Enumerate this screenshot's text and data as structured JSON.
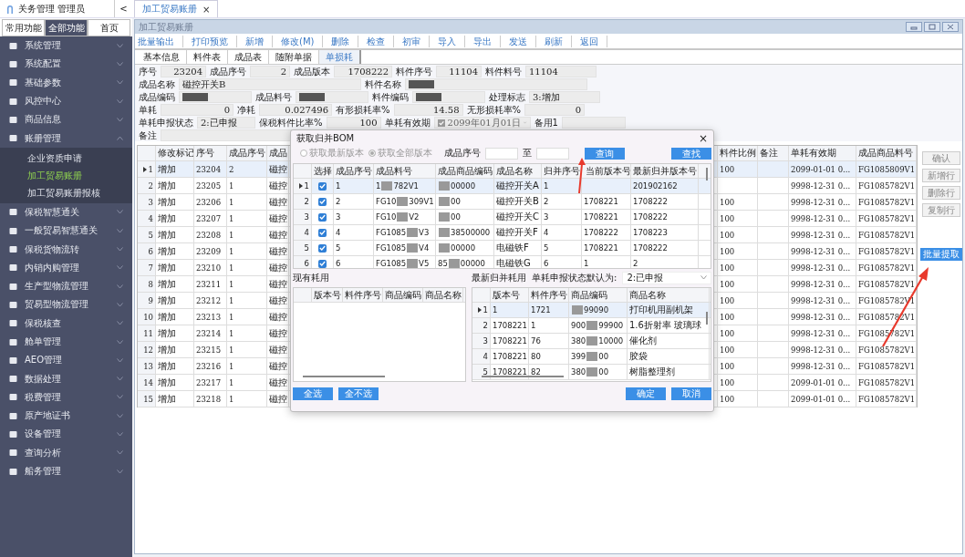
{
  "app_header": {
    "title": "关务管理 管理员",
    "collapse": "<"
  },
  "doc_tabs": [
    {
      "label": "加工贸易账册",
      "close": "×",
      "selected": true
    }
  ],
  "sidebar": {
    "tabs": [
      {
        "label": "常用功能",
        "selected": false
      },
      {
        "label": "全部功能",
        "selected": true
      },
      {
        "label": "首页",
        "selected": false
      }
    ],
    "items": [
      {
        "label": "系统管理",
        "expanded": false
      },
      {
        "label": "系统配置",
        "expanded": false
      },
      {
        "label": "基础参数",
        "expanded": false
      },
      {
        "label": "风控中心",
        "expanded": false
      },
      {
        "label": "商品信息",
        "expanded": false
      },
      {
        "label": "账册管理",
        "expanded": true,
        "children": [
          {
            "label": "企业资质申请",
            "selected": false
          },
          {
            "label": "加工贸易账册",
            "selected": true
          },
          {
            "label": "加工贸易账册报核",
            "selected": false
          }
        ]
      },
      {
        "label": "保税智慧通关",
        "expanded": false
      },
      {
        "label": "一般贸易智慧通关",
        "expanded": false
      },
      {
        "label": "保税货物流转",
        "expanded": false
      },
      {
        "label": "内销内购管理",
        "expanded": false
      },
      {
        "label": "生产型物流管理",
        "expanded": false
      },
      {
        "label": "贸易型物流管理",
        "expanded": false
      },
      {
        "label": "保税核查",
        "expanded": false
      },
      {
        "label": "舱单管理",
        "expanded": false
      },
      {
        "label": "AEO管理",
        "expanded": false
      },
      {
        "label": "数据处理",
        "expanded": false
      },
      {
        "label": "税费管理",
        "expanded": false
      },
      {
        "label": "原产地证书",
        "expanded": false
      },
      {
        "label": "设备管理",
        "expanded": false
      },
      {
        "label": "查询分析",
        "expanded": false
      },
      {
        "label": "船务管理",
        "expanded": false
      }
    ]
  },
  "window": {
    "title": "加工贸易账册",
    "toolbar": [
      "批量输出",
      "打印预览",
      "新增",
      "修改(M)",
      "删除",
      "检查",
      "初审",
      "导入",
      "导出",
      "发送",
      "刷新",
      "返回"
    ],
    "tabs": [
      {
        "label": "基本信息",
        "selected": false
      },
      {
        "label": "料件表",
        "selected": false
      },
      {
        "label": "成品表",
        "selected": false
      },
      {
        "label": "随附单据",
        "selected": false
      },
      {
        "label": "单损耗",
        "selected": true
      }
    ],
    "form": [
      [
        {
          "label": "序号",
          "value": "23204"
        },
        {
          "label": "成品序号",
          "value": "2"
        },
        {
          "label": "成品版本",
          "value": "1708222"
        },
        {
          "label": "料件序号",
          "value": "11104"
        },
        {
          "label": "料件料号",
          "value": "11104"
        }
      ],
      [
        {
          "label": "成品名称",
          "value": "磁控开关B"
        },
        {
          "label": "料件名称",
          "redacted": true
        }
      ],
      [
        {
          "label": "成品编码",
          "redacted": true
        },
        {
          "label": "成品料号",
          "redacted": true
        },
        {
          "label": "料件编码",
          "redacted": true
        },
        {
          "label": "处理标志",
          "value": "3:增加"
        }
      ],
      [
        {
          "label": "单耗",
          "value": "0"
        },
        {
          "label": "净耗",
          "value": "0.027496"
        },
        {
          "label": "有形损耗率%",
          "value": "14.58"
        },
        {
          "label": "无形损耗率%",
          "value": "0"
        }
      ],
      [
        {
          "label": "单耗申报状态",
          "value": "2:已申报"
        },
        {
          "label": "保税料件比率%",
          "value": "100"
        },
        {
          "label": "单耗有效期",
          "value": "2099年01月01日",
          "kind": "date",
          "checked": true,
          "disabled": true
        },
        {
          "label": "备用1"
        }
      ],
      [
        {
          "label": "备注"
        }
      ]
    ],
    "table": {
      "columns": [
        "修改标记",
        "序号",
        "成品序号",
        "成品",
        null,
        "料件比例",
        "备注",
        "单耗有效期",
        "成品商品料号"
      ],
      "rows": [
        {
          "number": "1",
          "selected": true,
          "cells": [
            "增加",
            "23204",
            "2",
            "磁控",
            null,
            "100",
            null,
            "2099-01-01 0...",
            "FG1085809V1"
          ]
        },
        {
          "number": "2",
          "selected": false,
          "cells": [
            "增加",
            "23205",
            "1",
            "磁控",
            null,
            null,
            null,
            "9998-12-31 0...",
            "FG1085782V1"
          ]
        },
        {
          "number": "3",
          "selected": false,
          "cells": [
            "增加",
            "23206",
            "1",
            "磁控",
            null,
            "100",
            null,
            "9998-12-31 0...",
            "FG1085782V1"
          ]
        },
        {
          "number": "4",
          "selected": false,
          "cells": [
            "增加",
            "23207",
            "1",
            "磁控",
            null,
            "100",
            null,
            "9998-12-31 0...",
            "FG1085782V1"
          ]
        },
        {
          "number": "5",
          "selected": false,
          "cells": [
            "增加",
            "23208",
            "1",
            "磁控",
            null,
            "100",
            null,
            "9998-12-31 0...",
            "FG1085782V1"
          ]
        },
        {
          "number": "6",
          "selected": false,
          "cells": [
            "增加",
            "23209",
            "1",
            "磁控",
            null,
            "100",
            null,
            "9998-12-31 0...",
            "FG1085782V1"
          ]
        },
        {
          "number": "7",
          "selected": false,
          "cells": [
            "增加",
            "23210",
            "1",
            "磁控",
            null,
            "100",
            null,
            "9998-12-31 0...",
            "FG1085782V1"
          ]
        },
        {
          "number": "8",
          "selected": false,
          "cells": [
            "增加",
            "23211",
            "1",
            "磁控",
            null,
            "100",
            null,
            "9998-12-31 0...",
            "FG1085782V1"
          ]
        },
        {
          "number": "9",
          "selected": false,
          "cells": [
            "增加",
            "23212",
            "1",
            "磁控",
            null,
            "100",
            null,
            "9998-12-31 0...",
            "FG1085782V1"
          ]
        },
        {
          "number": "10",
          "selected": false,
          "cells": [
            "增加",
            "23213",
            "1",
            "磁控",
            null,
            "100",
            null,
            "9998-12-31 0...",
            "FG1085782V1"
          ]
        },
        {
          "number": "11",
          "selected": false,
          "cells": [
            "增加",
            "23214",
            "1",
            "磁控",
            null,
            "100",
            null,
            "9998-12-31 0...",
            "FG1085782V1"
          ]
        },
        {
          "number": "12",
          "selected": false,
          "cells": [
            "增加",
            "23215",
            "1",
            "磁控",
            null,
            "100",
            null,
            "9998-12-31 0...",
            "FG1085782V1"
          ]
        },
        {
          "number": "13",
          "selected": false,
          "cells": [
            "增加",
            "23216",
            "1",
            "磁控",
            null,
            "100",
            null,
            "9998-12-31 0...",
            "FG1085782V1"
          ]
        },
        {
          "number": "14",
          "selected": false,
          "cells": [
            "增加",
            "23217",
            "1",
            "磁控",
            null,
            "100",
            null,
            "2099-01-01 0...",
            "FG1085782V1"
          ]
        },
        {
          "number": "15",
          "selected": false,
          "cells": [
            "增加",
            "23218",
            "1",
            "磁控",
            null,
            "100",
            null,
            "2099-01-01 0...",
            "FG1085782V1"
          ]
        }
      ]
    },
    "side_buttons": [
      {
        "label": "确认",
        "disabled": true
      },
      {
        "label": "新增行",
        "disabled": true
      },
      {
        "label": "删除行",
        "disabled": true
      },
      {
        "label": "复制行",
        "disabled": true
      }
    ],
    "batch_button": "批量提取"
  },
  "dialog": {
    "title": "获取归并BOM",
    "close": "×",
    "options": [
      {
        "label": "获取最新版本",
        "selected": false
      },
      {
        "label": "获取全部版本",
        "selected": true
      }
    ],
    "range_label": "成品序号",
    "range_to": "至",
    "query_button": "查询",
    "find_button": "查找",
    "grid": {
      "check_column": "选择",
      "columns": [
        "成品序号",
        "成品料号",
        "成品商品编码",
        "成品名称",
        "归并序号",
        "当前版本号",
        "最新归并版本号"
      ],
      "rows": [
        {
          "number": "1",
          "selected": true,
          "checked": true,
          "cells": [
            [
              "1"
            ],
            [
              "1",
              "782V1"
            ],
            [
              "00000"
            ],
            [
              "磁控开关A"
            ],
            [
              "1"
            ],
            [],
            [
              "201902162"
            ]
          ]
        },
        {
          "number": "2",
          "selected": false,
          "checked": true,
          "cells": [
            [
              "2"
            ],
            [
              "FG10",
              "309V1"
            ],
            [
              "00"
            ],
            [
              "磁控开关B"
            ],
            [
              "2"
            ],
            [
              "1708221"
            ],
            [
              "1708222"
            ]
          ]
        },
        {
          "number": "3",
          "selected": false,
          "checked": true,
          "cells": [
            [
              "3"
            ],
            [
              "FG10",
              "V2"
            ],
            [
              "00"
            ],
            [
              "磁控开关C"
            ],
            [
              "3"
            ],
            [
              "1708221"
            ],
            [
              "1708222"
            ]
          ]
        },
        {
          "number": "4",
          "selected": false,
          "checked": true,
          "cells": [
            [
              "4"
            ],
            [
              "FG1085",
              "V3"
            ],
            [
              "38500000"
            ],
            [
              "磁控开关F"
            ],
            [
              "4"
            ],
            [
              "1708222"
            ],
            [
              "1708223"
            ]
          ]
        },
        {
          "number": "5",
          "selected": false,
          "checked": true,
          "cells": [
            [
              "5"
            ],
            [
              "FG1085",
              "V4"
            ],
            [
              "00000"
            ],
            [
              "电磁铁F"
            ],
            [
              "5"
            ],
            [
              "1708221"
            ],
            [
              "1708222"
            ]
          ]
        },
        {
          "number": "6",
          "selected": false,
          "checked": true,
          "cells": [
            [
              "6"
            ],
            [
              "FG1085",
              "V5"
            ],
            [
              "85",
              "00000"
            ],
            [
              "电磁铁G"
            ],
            [
              "6"
            ],
            [
              "1"
            ],
            [
              "2"
            ]
          ]
        }
      ]
    },
    "existing": {
      "title": "现有耗用",
      "columns": [
        "版本号",
        "料件序号",
        "商品编码",
        "商品名称"
      ]
    },
    "latest": {
      "title": "最新归并耗用",
      "status_label": "单耗申报状态默认为:",
      "status_value": "2:已申报",
      "columns": [
        "版本号",
        "料件序号",
        "商品编码",
        "商品名称"
      ],
      "rows": [
        {
          "number": "1",
          "selected": true,
          "cells": [
            [
              "1"
            ],
            [
              "1721"
            ],
            [
              "99090"
            ],
            [
              "打印机用副机架"
            ]
          ]
        },
        {
          "number": "2",
          "selected": false,
          "cells": [
            [
              "1708221"
            ],
            [
              "1"
            ],
            [
              "900",
              "99900"
            ],
            [
              "1.6折射率 玻璃球"
            ]
          ]
        },
        {
          "number": "3",
          "selected": false,
          "cells": [
            [
              "1708221"
            ],
            [
              "76"
            ],
            [
              "380",
              "10000"
            ],
            [
              "催化剂"
            ]
          ]
        },
        {
          "number": "4",
          "selected": false,
          "cells": [
            [
              "1708221"
            ],
            [
              "80"
            ],
            [
              "399",
              "00"
            ],
            [
              "胶袋"
            ]
          ]
        },
        {
          "number": "5",
          "selected": false,
          "cells": [
            [
              "1708221"
            ],
            [
              "82"
            ],
            [
              "380",
              "00"
            ],
            [
              "树脂整理剂"
            ]
          ]
        }
      ]
    },
    "buttons_left": [
      "全选",
      "全不选"
    ],
    "buttons_right": [
      "确定",
      "取消"
    ]
  }
}
